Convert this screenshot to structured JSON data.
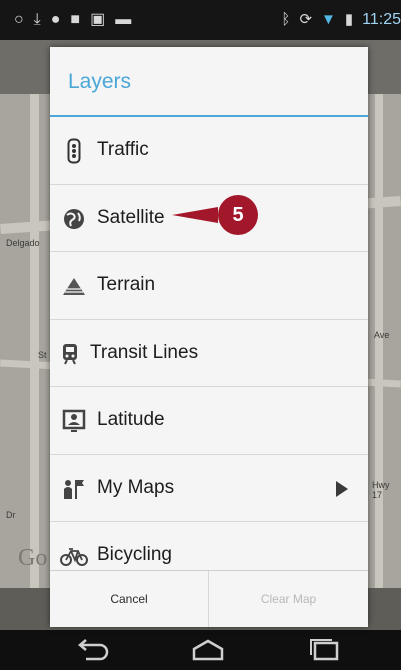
{
  "status_bar": {
    "time": "11:25",
    "left_icons": [
      "ring-icon",
      "download-icon",
      "chat-icon",
      "app-icon",
      "image-icon",
      "game-icon"
    ],
    "right_icons": [
      "bluetooth-icon",
      "rotate-icon",
      "wifi-icon",
      "battery-icon"
    ]
  },
  "map": {
    "labels": [
      "Delgado",
      "St",
      "Ave",
      "Hwy 17",
      "Dr"
    ],
    "watermark": "Go"
  },
  "dialog": {
    "title": "Layers",
    "items": [
      {
        "label": "Traffic",
        "icon": "traffic-light-icon"
      },
      {
        "label": "Satellite",
        "icon": "globe-icon"
      },
      {
        "label": "Terrain",
        "icon": "terrain-icon"
      },
      {
        "label": "Transit Lines",
        "icon": "train-icon"
      },
      {
        "label": "Latitude",
        "icon": "latitude-icon"
      },
      {
        "label": "My Maps",
        "icon": "my-maps-icon"
      },
      {
        "label": "Bicycling",
        "icon": "bicycle-icon"
      }
    ],
    "cancel_label": "Cancel",
    "clear_label": "Clear Map"
  },
  "callout": {
    "number": "5",
    "color": "#a3172b"
  },
  "accent_color": "#4aa7d8",
  "nav": [
    "back-icon",
    "home-icon",
    "recents-icon"
  ]
}
